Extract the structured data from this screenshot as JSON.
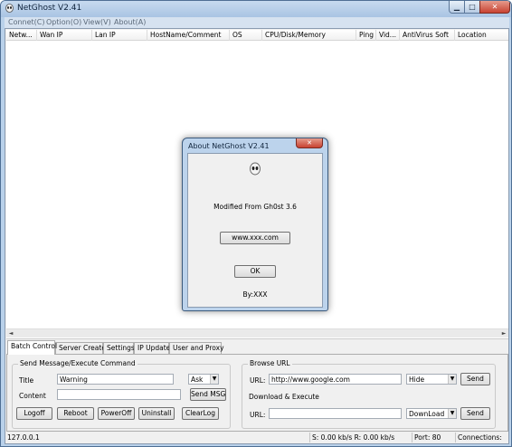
{
  "window": {
    "title": "NetGhost V2.41",
    "min_glyph": "▁",
    "max_glyph": "□",
    "close_glyph": "✕"
  },
  "menu": [
    "Connet(C)",
    "Option(O)",
    "View(V)",
    "About(A)"
  ],
  "list": {
    "columns": [
      "Netw...",
      "Wan IP",
      "Lan IP",
      "HostName/Comment",
      "OS",
      "CPU/Disk/Memory",
      "Ping",
      "Vid...",
      "AntiVirus Soft",
      "Location"
    ],
    "rows": []
  },
  "scroll": {
    "left": "◄",
    "right": "►"
  },
  "tabs": [
    "Batch Control",
    "Server Create",
    "Settings",
    "IP Update",
    "User and Proxy"
  ],
  "send_group": {
    "title": "Send Message/Execute Command",
    "title_label": "Title",
    "title_value": "Warning",
    "type_value": "Ask",
    "content_label": "Content",
    "content_value": "",
    "send_msg_button": "Send MSG",
    "buttons": [
      "Logoff",
      "Reboot",
      "PowerOff",
      "Uninstall",
      "ClearLog"
    ]
  },
  "browse_group": {
    "title": "Browse URL",
    "url_label": "URL:",
    "url_value": "http://www.google.com",
    "mode_value": "Hide",
    "send_button": "Send",
    "download_title": "Download & Execute",
    "dl_url_label": "URL:",
    "dl_url_value": "",
    "dl_mode_value": "DownLoad",
    "dl_send_button": "Send"
  },
  "status": {
    "ip": "127.0.0.1",
    "speed": "S: 0.00 kb/s R: 0.00 kb/s",
    "port": "Port: 80",
    "connections": "Connections:"
  },
  "dialog": {
    "title": "About NetGhost V2.41",
    "close_glyph": "✕",
    "subtitle": "Modified From Gh0st 3.6",
    "link": "www.xxx.com",
    "ok": "OK",
    "by": "By:XXX"
  },
  "colors": {
    "titlebar": "#b9d1ea",
    "close": "#c84232"
  }
}
